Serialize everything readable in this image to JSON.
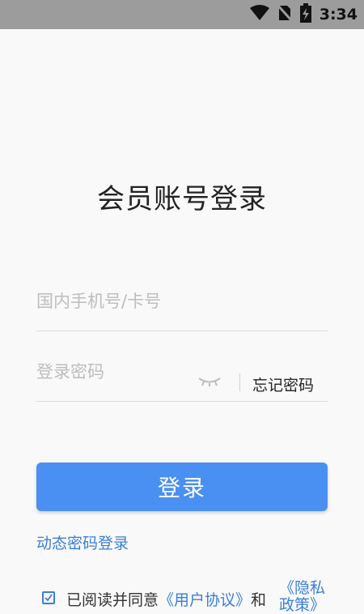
{
  "status_bar": {
    "time": "3:34",
    "icons": [
      "wifi-icon",
      "no-sim-icon",
      "battery-charging-icon"
    ]
  },
  "login": {
    "title": "会员账号登录",
    "phone_placeholder": "国内手机号/卡号",
    "password_placeholder": "登录密码",
    "forgot_password": "忘记密码",
    "login_button": "登录",
    "dynamic_password_login": "动态密码登录"
  },
  "agreement": {
    "prefix": "已阅读并同意",
    "user_agreement": "《用户协议》",
    "and": "和",
    "privacy_policy": "《隐私政策》"
  },
  "colors": {
    "accent": "#4a8ff2",
    "link": "#3a7fd5",
    "status_bar": "#9c9c9c",
    "background": "#f9f9f9"
  }
}
